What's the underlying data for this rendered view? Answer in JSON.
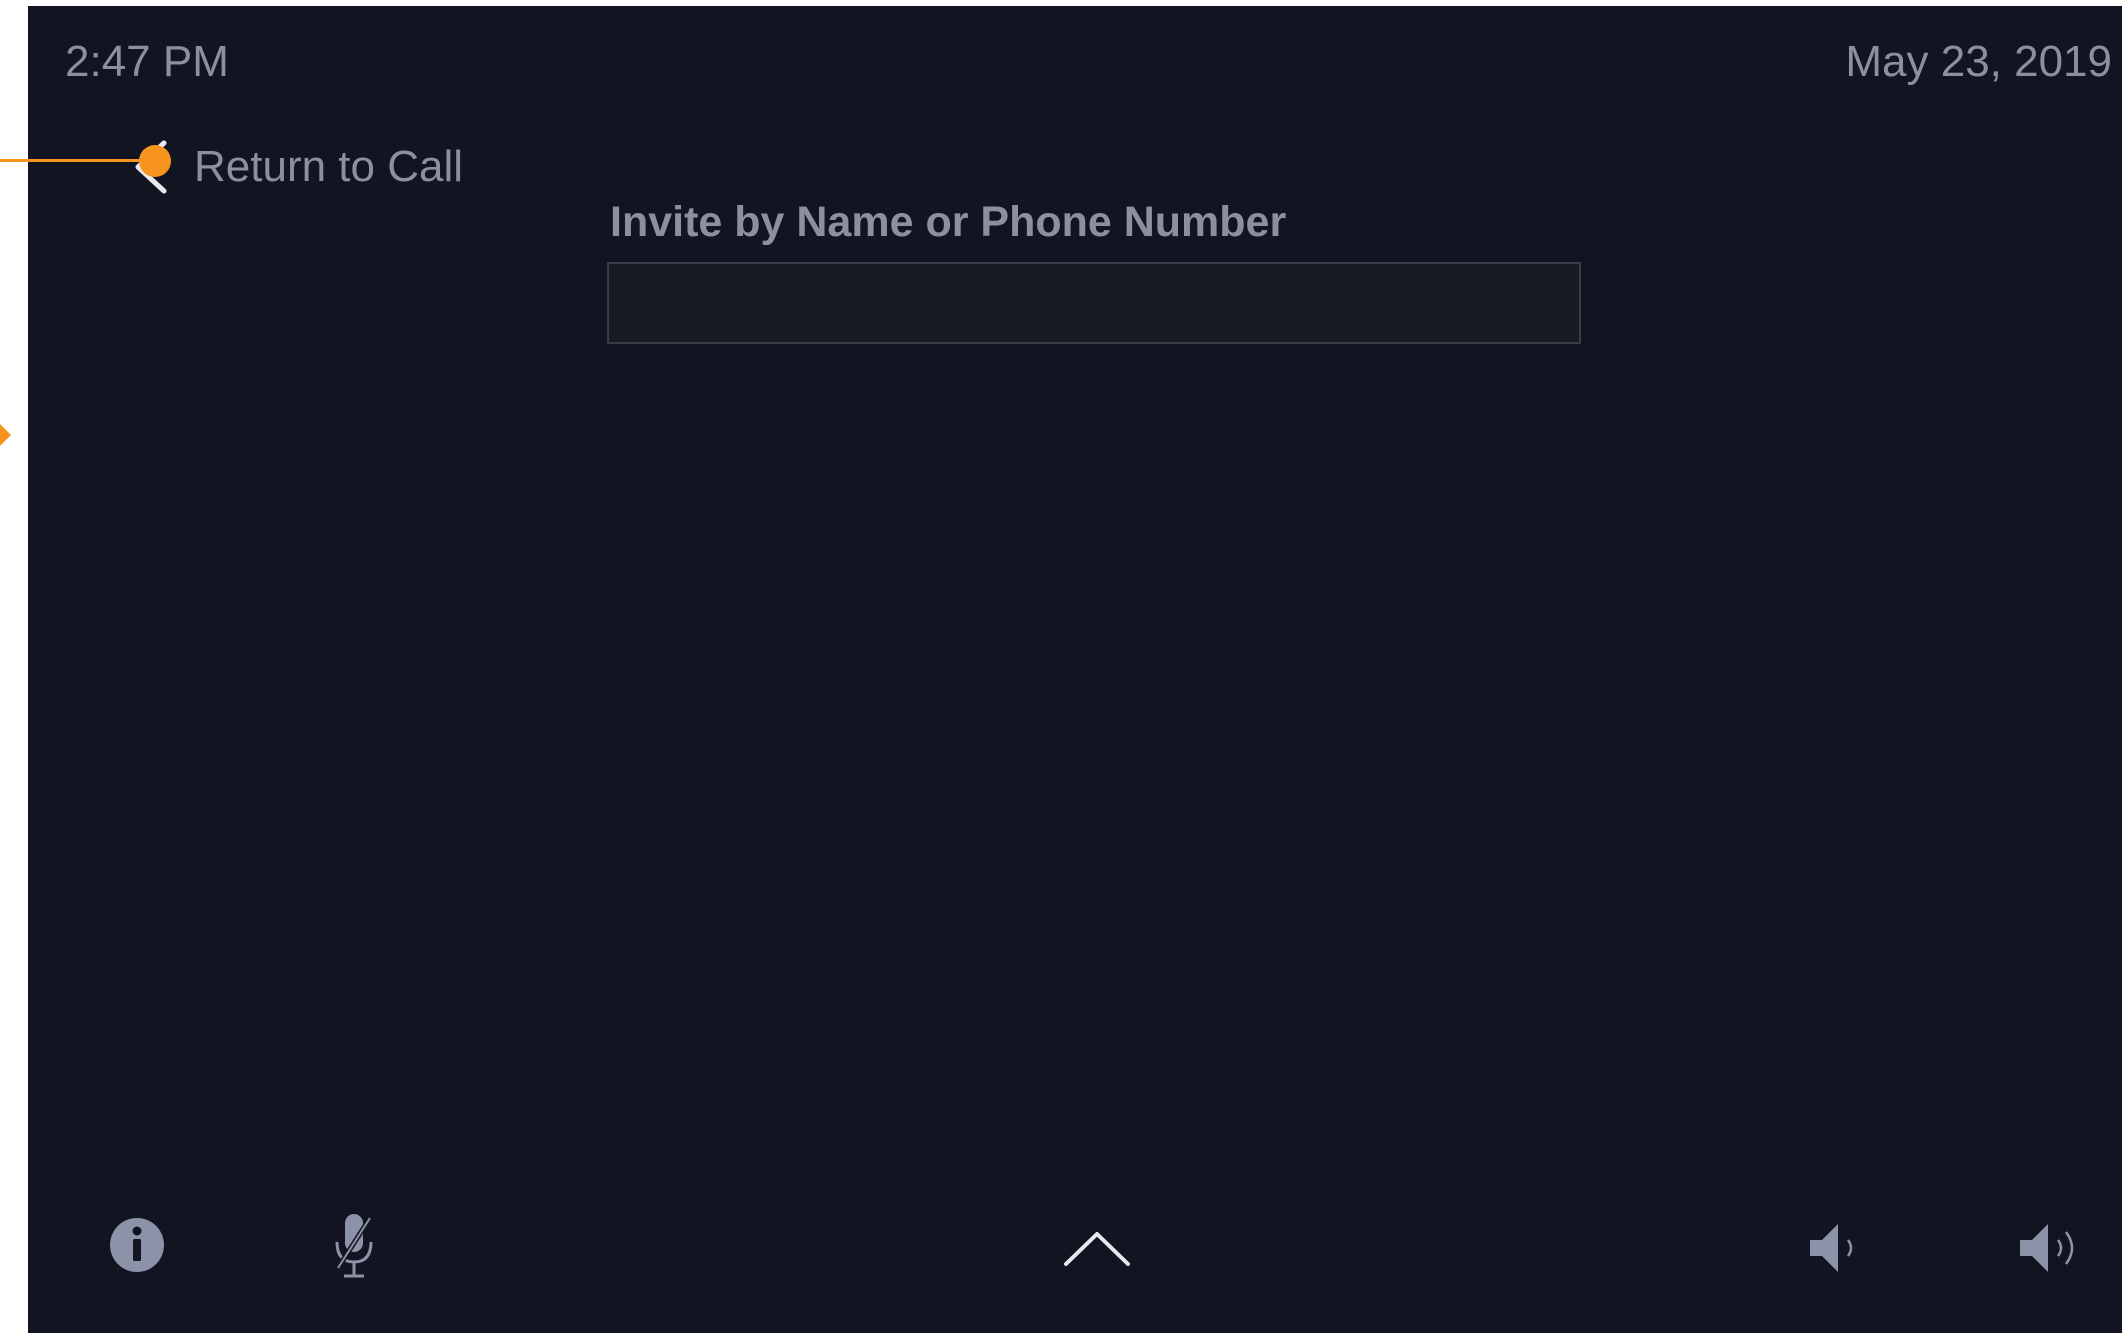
{
  "status_bar": {
    "time": "2:47 PM",
    "date": "May 23, 2019"
  },
  "navigation": {
    "back_label": "Return to Call"
  },
  "invite": {
    "label": "Invite by Name or Phone Number",
    "value": "",
    "placeholder": ""
  },
  "bottom_bar": {
    "icons": [
      "info-icon",
      "microphone-muted-icon",
      "chevron-up-icon",
      "volume-down-icon",
      "volume-up-icon"
    ]
  },
  "colors": {
    "background": "#121521",
    "text": "#8c909c",
    "icon": "#8c93a8",
    "annotation": "#f7941d"
  }
}
